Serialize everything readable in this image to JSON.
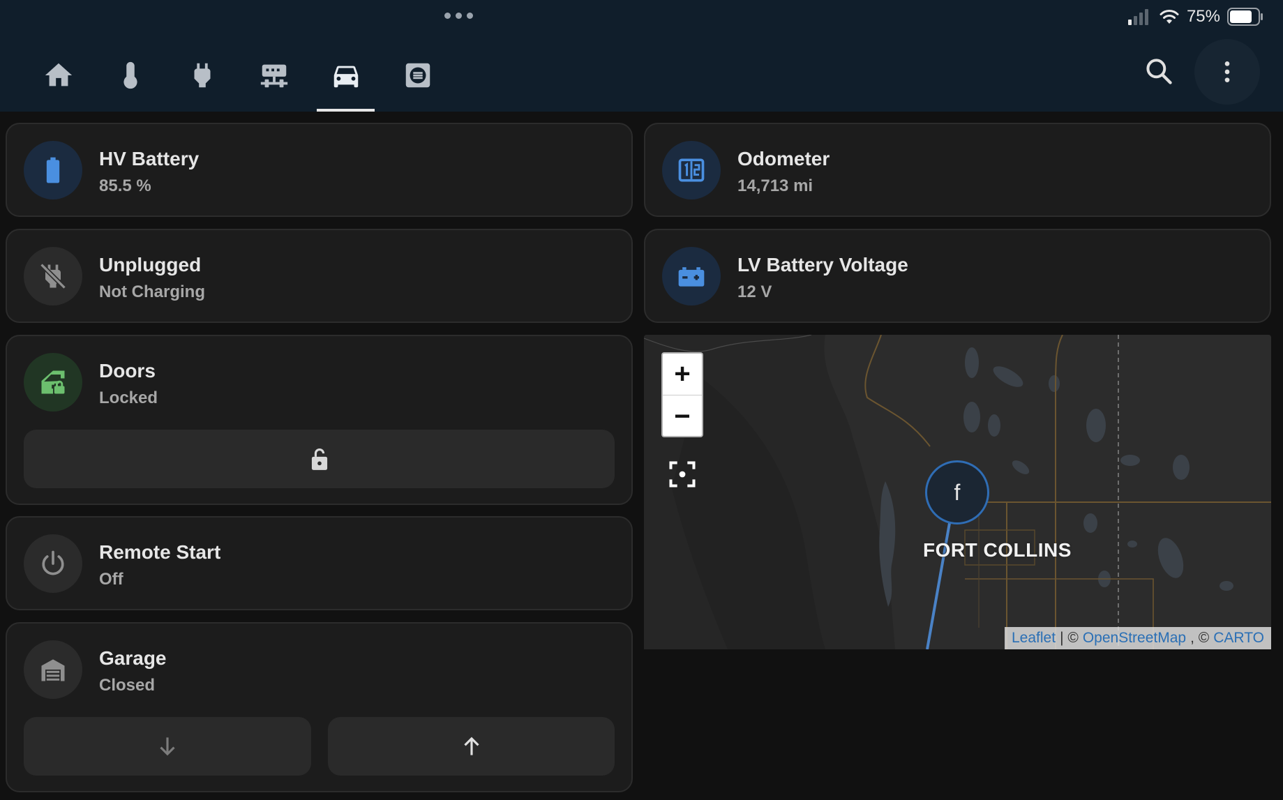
{
  "status_bar": {
    "battery_percent": "75%"
  },
  "tabs": [
    {
      "icon": "home-icon"
    },
    {
      "icon": "thermometer-icon"
    },
    {
      "icon": "plug-icon"
    },
    {
      "icon": "network-icon"
    },
    {
      "icon": "car-icon",
      "active": true
    },
    {
      "icon": "list-box-icon"
    }
  ],
  "cards": {
    "hv_battery": {
      "title": "HV Battery",
      "value": "85.5 %",
      "icon": "battery-icon"
    },
    "unplugged": {
      "title": "Unplugged",
      "value": "Not Charging",
      "icon": "power-plug-off-icon"
    },
    "doors": {
      "title": "Doors",
      "value": "Locked",
      "icon": "car-door-lock-icon",
      "action_icon": "lock-open-icon"
    },
    "remote_start": {
      "title": "Remote Start",
      "value": "Off",
      "icon": "power-icon"
    },
    "garage": {
      "title": "Garage",
      "value": "Closed",
      "icon": "garage-icon",
      "actions": [
        "arrow-down-icon",
        "arrow-up-icon"
      ]
    },
    "odometer": {
      "title": "Odometer",
      "value": "14,713 mi",
      "icon": "counter-icon"
    },
    "lv_battery": {
      "title": "LV Battery Voltage",
      "value": "12 V",
      "icon": "car-battery-icon"
    }
  },
  "map": {
    "zoom_in": "+",
    "zoom_out": "−",
    "marker_label": "f",
    "city_label": "FORT COLLINS",
    "attribution": {
      "leaflet": "Leaflet",
      "sep1": "| ©",
      "osm": "OpenStreetMap",
      "sep2": ", ©",
      "carto": "CARTO"
    }
  },
  "colors": {
    "header_bg": "#101e2b",
    "card_bg": "#1c1c1c",
    "accent_blue": "#4a8fe0",
    "accent_green": "#6cbf6e"
  }
}
